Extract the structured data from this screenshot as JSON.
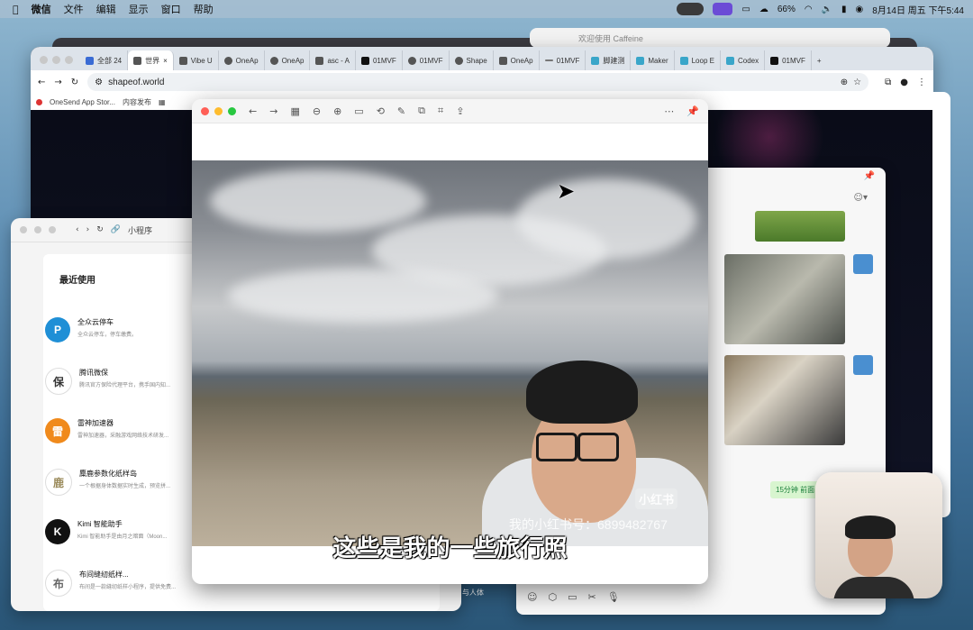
{
  "menubar": {
    "app": "微信",
    "menus": [
      "文件",
      "编辑",
      "显示",
      "窗口",
      "帮助"
    ],
    "battery_text": "66%",
    "datetime": "8月14日 周五  下午5:44"
  },
  "caffeine_title": "欢迎使用 Caffeine",
  "chrome": {
    "tabs": [
      "全部 24",
      "世界",
      "Vibe U",
      "OneAp",
      "OneAp",
      "asc - A",
      "01MVF",
      "01MVF",
      "Shape",
      "OneAp",
      "01MVF",
      "脚建测",
      "Maker",
      "Loop E",
      "Codex",
      "01MVF"
    ],
    "add_tab": "+",
    "url": "shapeof.world",
    "bookmarks": [
      "OneSend App Stor...",
      "内容发布"
    ]
  },
  "mini": {
    "address": "小程序",
    "section_title": "最近使用",
    "items": [
      {
        "name": "全众云停车",
        "desc": "全众云停车，停车缴费。",
        "icon_text": "P",
        "color": "#1f8fd6"
      },
      {
        "name": "腾讯微保",
        "desc": "腾讯官方保险代理平台，携手国内知...",
        "icon_text": "保",
        "color": "#ffffff"
      },
      {
        "name": "雷神加速器",
        "desc": "雷神加速器，采融游戏网络技术研发...",
        "icon_text": "雷",
        "color": "#f08a1c"
      },
      {
        "name": "麋鹿参数化纸样岛",
        "desc": "一个根据身体数据实时生成，预览拼...",
        "icon_text": "鹿",
        "color": "#ffffff"
      },
      {
        "name": "Kimi 智能助手",
        "desc": "Kimi 智能助手是由月之暗面（Moon...",
        "icon_text": "K",
        "color": "#111111"
      },
      {
        "name": "布间缝纫纸样...",
        "desc": "布间是一款缝纫纸样小程序，提供免费...",
        "icon_text": "布",
        "color": "#ffffff"
      }
    ],
    "footer_fragment": "与人体"
  },
  "viewer": {
    "watermark": "我的小红书号：6899482767",
    "brand": "小红书",
    "caption": "这些是我的一些旅行照"
  },
  "chat": {
    "message_badge": "15分钟 前面"
  }
}
